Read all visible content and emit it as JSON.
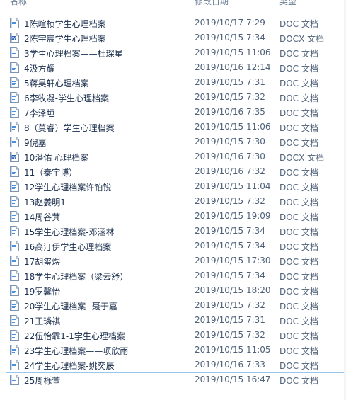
{
  "columns": {
    "name": "名称",
    "date": "修改日期",
    "type": "类型"
  },
  "files": [
    {
      "name": "1陈暄桢学生心理档案",
      "date": "2019/10/17 7:29",
      "type": "DOC 文档",
      "icon": "doc-file-icon"
    },
    {
      "name": "2陈宇宸学生心理档案",
      "date": "2019/10/15 7:34",
      "type": "DOCX 文档",
      "icon": "docx-file-icon"
    },
    {
      "name": "3学生心理档案——杜琛星",
      "date": "2019/10/15 11:06",
      "type": "DOC 文档",
      "icon": "doc-file-icon"
    },
    {
      "name": "4汲方耀",
      "date": "2019/10/16 12:14",
      "type": "DOC 文档",
      "icon": "doc-file-icon"
    },
    {
      "name": "5蒋昊轩心理档案",
      "date": "2019/10/15 7:31",
      "type": "DOC 文档",
      "icon": "doc-file-icon"
    },
    {
      "name": "6李牧凝-学生心理档案",
      "date": "2019/10/15 7:32",
      "type": "DOC 文档",
      "icon": "doc-file-icon"
    },
    {
      "name": "7李泽垣",
      "date": "2019/10/16 7:35",
      "type": "DOC 文档",
      "icon": "doc-file-icon"
    },
    {
      "name": "8（莫睿）学生心理档案",
      "date": "2019/10/15 11:06",
      "type": "DOC 文档",
      "icon": "doc-file-icon"
    },
    {
      "name": "9倪嘉",
      "date": "2019/10/15 7:30",
      "type": "DOC 文档",
      "icon": "doc-file-icon"
    },
    {
      "name": "10潘佑 心理档案",
      "date": "2019/10/16 7:30",
      "type": "DOCX 文档",
      "icon": "docx-file-icon"
    },
    {
      "name": "11（秦宇博）",
      "date": "2019/10/16 7:32",
      "type": "DOC 文档",
      "icon": "doc-file-icon"
    },
    {
      "name": "12学生心理档案许铂锐",
      "date": "2019/10/15 11:04",
      "type": "DOC 文档",
      "icon": "doc-file-icon"
    },
    {
      "name": "13赵姜明1",
      "date": "2019/10/15 7:32",
      "type": "DOC 文档",
      "icon": "doc-file-icon"
    },
    {
      "name": "14周谷萁",
      "date": "2019/10/15 19:09",
      "type": "DOC 文档",
      "icon": "doc-file-icon"
    },
    {
      "name": "15学生心理档案-邓涵林",
      "date": "2019/10/15 7:34",
      "type": "DOC 文档",
      "icon": "doc-file-icon"
    },
    {
      "name": "16高汀伊学生心理档案",
      "date": "2019/10/15 7:34",
      "type": "DOC 文档",
      "icon": "doc-file-icon"
    },
    {
      "name": "17胡玺煜",
      "date": "2019/10/15 17:30",
      "type": "DOC 文档",
      "icon": "doc-file-icon"
    },
    {
      "name": "18学生心理档案（梁云舒）",
      "date": "2019/10/15 7:34",
      "type": "DOC 文档",
      "icon": "doc-file-icon"
    },
    {
      "name": "19罗馨怡",
      "date": "2019/10/15 18:20",
      "type": "DOC 文档",
      "icon": "doc-file-icon"
    },
    {
      "name": "20学生心理档案--聂于嘉",
      "date": "2019/10/15 7:32",
      "type": "DOC 文档",
      "icon": "doc-file-icon"
    },
    {
      "name": "21王璘祺",
      "date": "2019/10/15 7:31",
      "type": "DOC 文档",
      "icon": "doc-file-icon"
    },
    {
      "name": "22伍怡霏1-1学生心理档案",
      "date": "2019/10/15 7:32",
      "type": "DOC 文档",
      "icon": "doc-file-icon"
    },
    {
      "name": "23学生心理档案——项欣雨",
      "date": "2019/10/15 11:05",
      "type": "DOC 文档",
      "icon": "doc-file-icon"
    },
    {
      "name": "24学生心理档案-姚奕辰",
      "date": "2019/10/16 7:33",
      "type": "DOC 文档",
      "icon": "doc-file-icon"
    },
    {
      "name": "25周栎萱",
      "date": "2019/10/15 16:47",
      "type": "DOC 文档",
      "icon": "doc-file-icon",
      "focused": true
    }
  ]
}
